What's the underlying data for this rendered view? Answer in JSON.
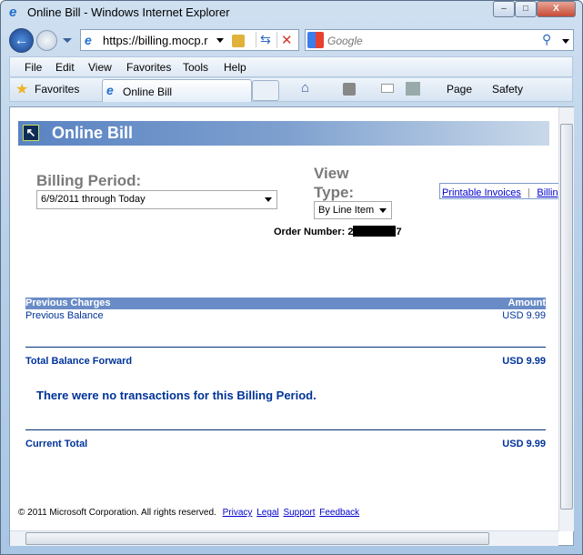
{
  "window": {
    "title": "Online Bill - Windows Internet Explorer",
    "minimize": "–",
    "maximize": "□",
    "close": "X"
  },
  "address": {
    "url": "https://billing.mocp.r"
  },
  "search": {
    "placeholder": "Google"
  },
  "menu": [
    "File",
    "Edit",
    "View",
    "Favorites",
    "Tools",
    "Help"
  ],
  "toolbar": {
    "favorites": "Favorites",
    "tab_title": "Online Bill",
    "page": "Page",
    "safety": "Safety"
  },
  "page": {
    "banner_title": "Online Bill",
    "billing_period_label": "Billing Period:",
    "billing_period_value": "6/9/2011 through Today",
    "view_type_label_1": "View",
    "view_type_label_2": "Type:",
    "view_type_value": "By Line Item",
    "links": [
      "Printable Invoices",
      "Billing"
    ],
    "link_sep": "|",
    "order_number_label": "Order Number:",
    "order_number_start": "2",
    "order_number_end": "7",
    "table": {
      "header_left": "Previous Charges",
      "header_right": "Amount",
      "rows": [
        {
          "label": "Previous Balance",
          "amount": "USD 9.99"
        }
      ]
    },
    "total_balance_forward": {
      "label": "Total Balance Forward",
      "amount": "USD 9.99"
    },
    "no_transactions": "There were no transactions for this Billing Period.",
    "current_total": {
      "label": "Current Total",
      "amount": "USD 9.99"
    },
    "footer": {
      "copyright": "© 2011 Microsoft Corporation. All rights reserved.",
      "links": [
        "Privacy",
        "Legal",
        "Support",
        "Feedback"
      ]
    }
  },
  "colors": {
    "banner": "#5983c2",
    "header_bar": "#6a8cc6",
    "text_navy": "#003399"
  }
}
